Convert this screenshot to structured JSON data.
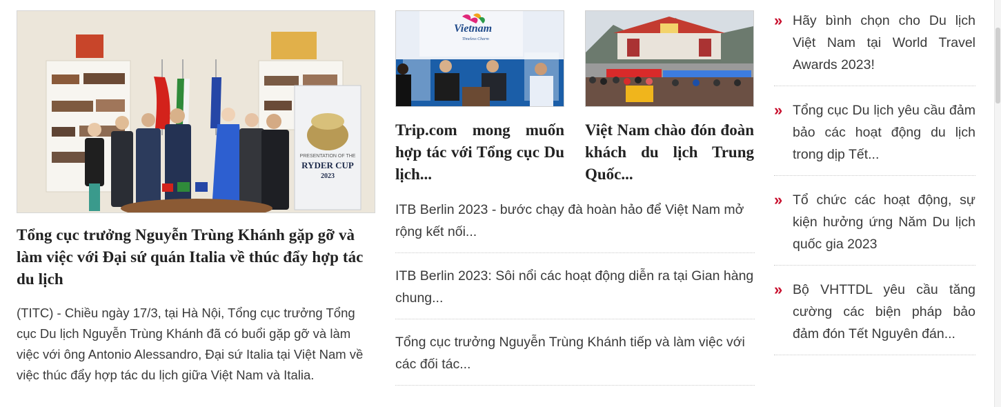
{
  "featured": {
    "title": "Tổng cục trưởng Nguyễn Trùng Khánh gặp gỡ và làm việc với Đại sứ quán Italia về thúc đẩy hợp tác du lịch",
    "summary": "(TITC) - Chiều ngày 17/3, tại Hà Nội, Tổng cục trưởng Tổng cục Du lịch Nguyễn Trùng Khánh đã có buổi gặp gỡ và làm việc với ông Antonio Alessandro, Đại sứ Italia tại Việt Nam về việc thúc đẩy hợp tác du lịch giữa Việt Nam và Italia.",
    "image_poster_line1": "PRESENTATION OF THE",
    "image_poster_line2": "RYDER CUP",
    "image_poster_line3": "2023"
  },
  "cards": [
    {
      "title": "Trip.com mong muốn hợp tác với Tổng cục Du lịch...",
      "logo_text": "Vietnam",
      "logo_tagline": "Timeless Charm"
    },
    {
      "title": "Việt Nam chào đón đoàn khách du lịch Trung Quốc..."
    }
  ],
  "middle_list": [
    "ITB Berlin 2023 - bước chạy đà hoàn hảo để Việt Nam mở rộng kết nối...",
    "ITB Berlin 2023: Sôi nổi các hoạt động diễn ra tại Gian hàng chung...",
    "Tổng cục trưởng Nguyễn Trùng Khánh tiếp và làm việc với các đối tác..."
  ],
  "right_list": {
    "arrow": "»",
    "items": [
      "Hãy bình chọn cho Du lịch Việt Nam tại World Travel Awards 2023!",
      "Tổng cục Du lịch yêu cầu đảm bảo các hoạt động du lịch trong dịp Tết...",
      "Tổ chức các hoạt động, sự kiện hưởng ứng Năm Du lịch quốc gia 2023",
      "Bộ VHTTDL yêu cầu tăng cường các biện pháp bảo đảm đón Tết Nguyên đán..."
    ]
  },
  "colors": {
    "accent_red": "#c8102e",
    "text": "#333333",
    "divider": "#c9c9c9"
  }
}
